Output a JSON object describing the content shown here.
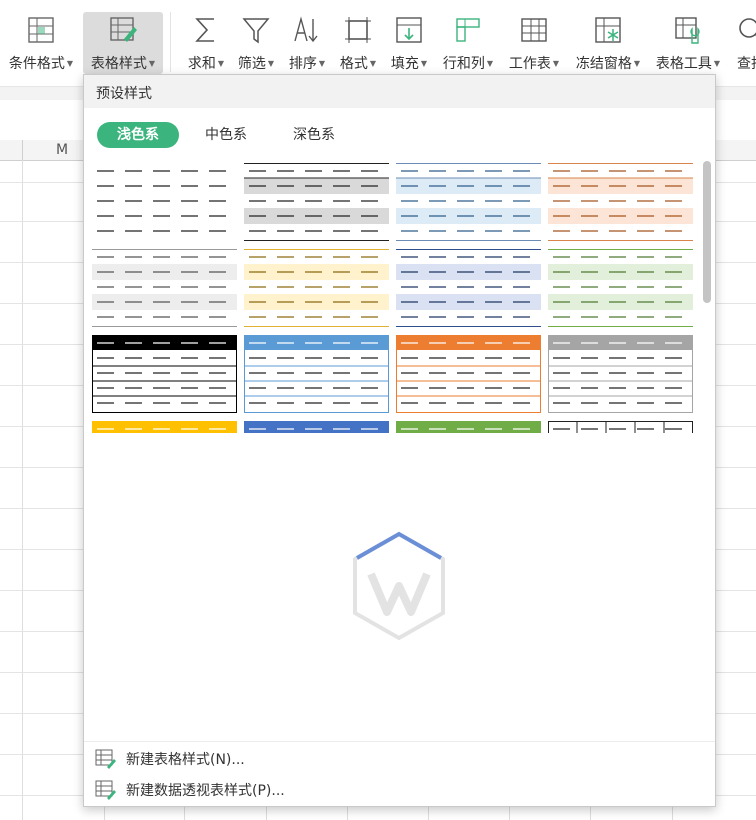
{
  "ribbon": {
    "buttons": [
      {
        "label": "条件格式",
        "icon": "conditional-format-icon"
      },
      {
        "label": "表格样式",
        "icon": "table-style-icon"
      },
      {
        "label": "求和",
        "icon": "sum-icon"
      },
      {
        "label": "筛选",
        "icon": "filter-icon"
      },
      {
        "label": "排序",
        "icon": "sort-icon"
      },
      {
        "label": "格式",
        "icon": "format-icon"
      },
      {
        "label": "填充",
        "icon": "fill-icon"
      },
      {
        "label": "行和列",
        "icon": "row-col-icon"
      },
      {
        "label": "工作表",
        "icon": "worksheet-icon"
      },
      {
        "label": "冻结窗格",
        "icon": "freeze-pane-icon"
      },
      {
        "label": "表格工具",
        "icon": "table-tools-icon"
      },
      {
        "label": "查找",
        "icon": "find-icon"
      }
    ],
    "active": "表格样式"
  },
  "sheet": {
    "visible_column": "M"
  },
  "popup": {
    "title": "预设样式",
    "tabs": [
      "浅色系",
      "中色系",
      "深色系"
    ],
    "active_tab": "浅色系",
    "actions": [
      "新建表格样式(N)...",
      "新建数据透视表样式(P)..."
    ]
  }
}
